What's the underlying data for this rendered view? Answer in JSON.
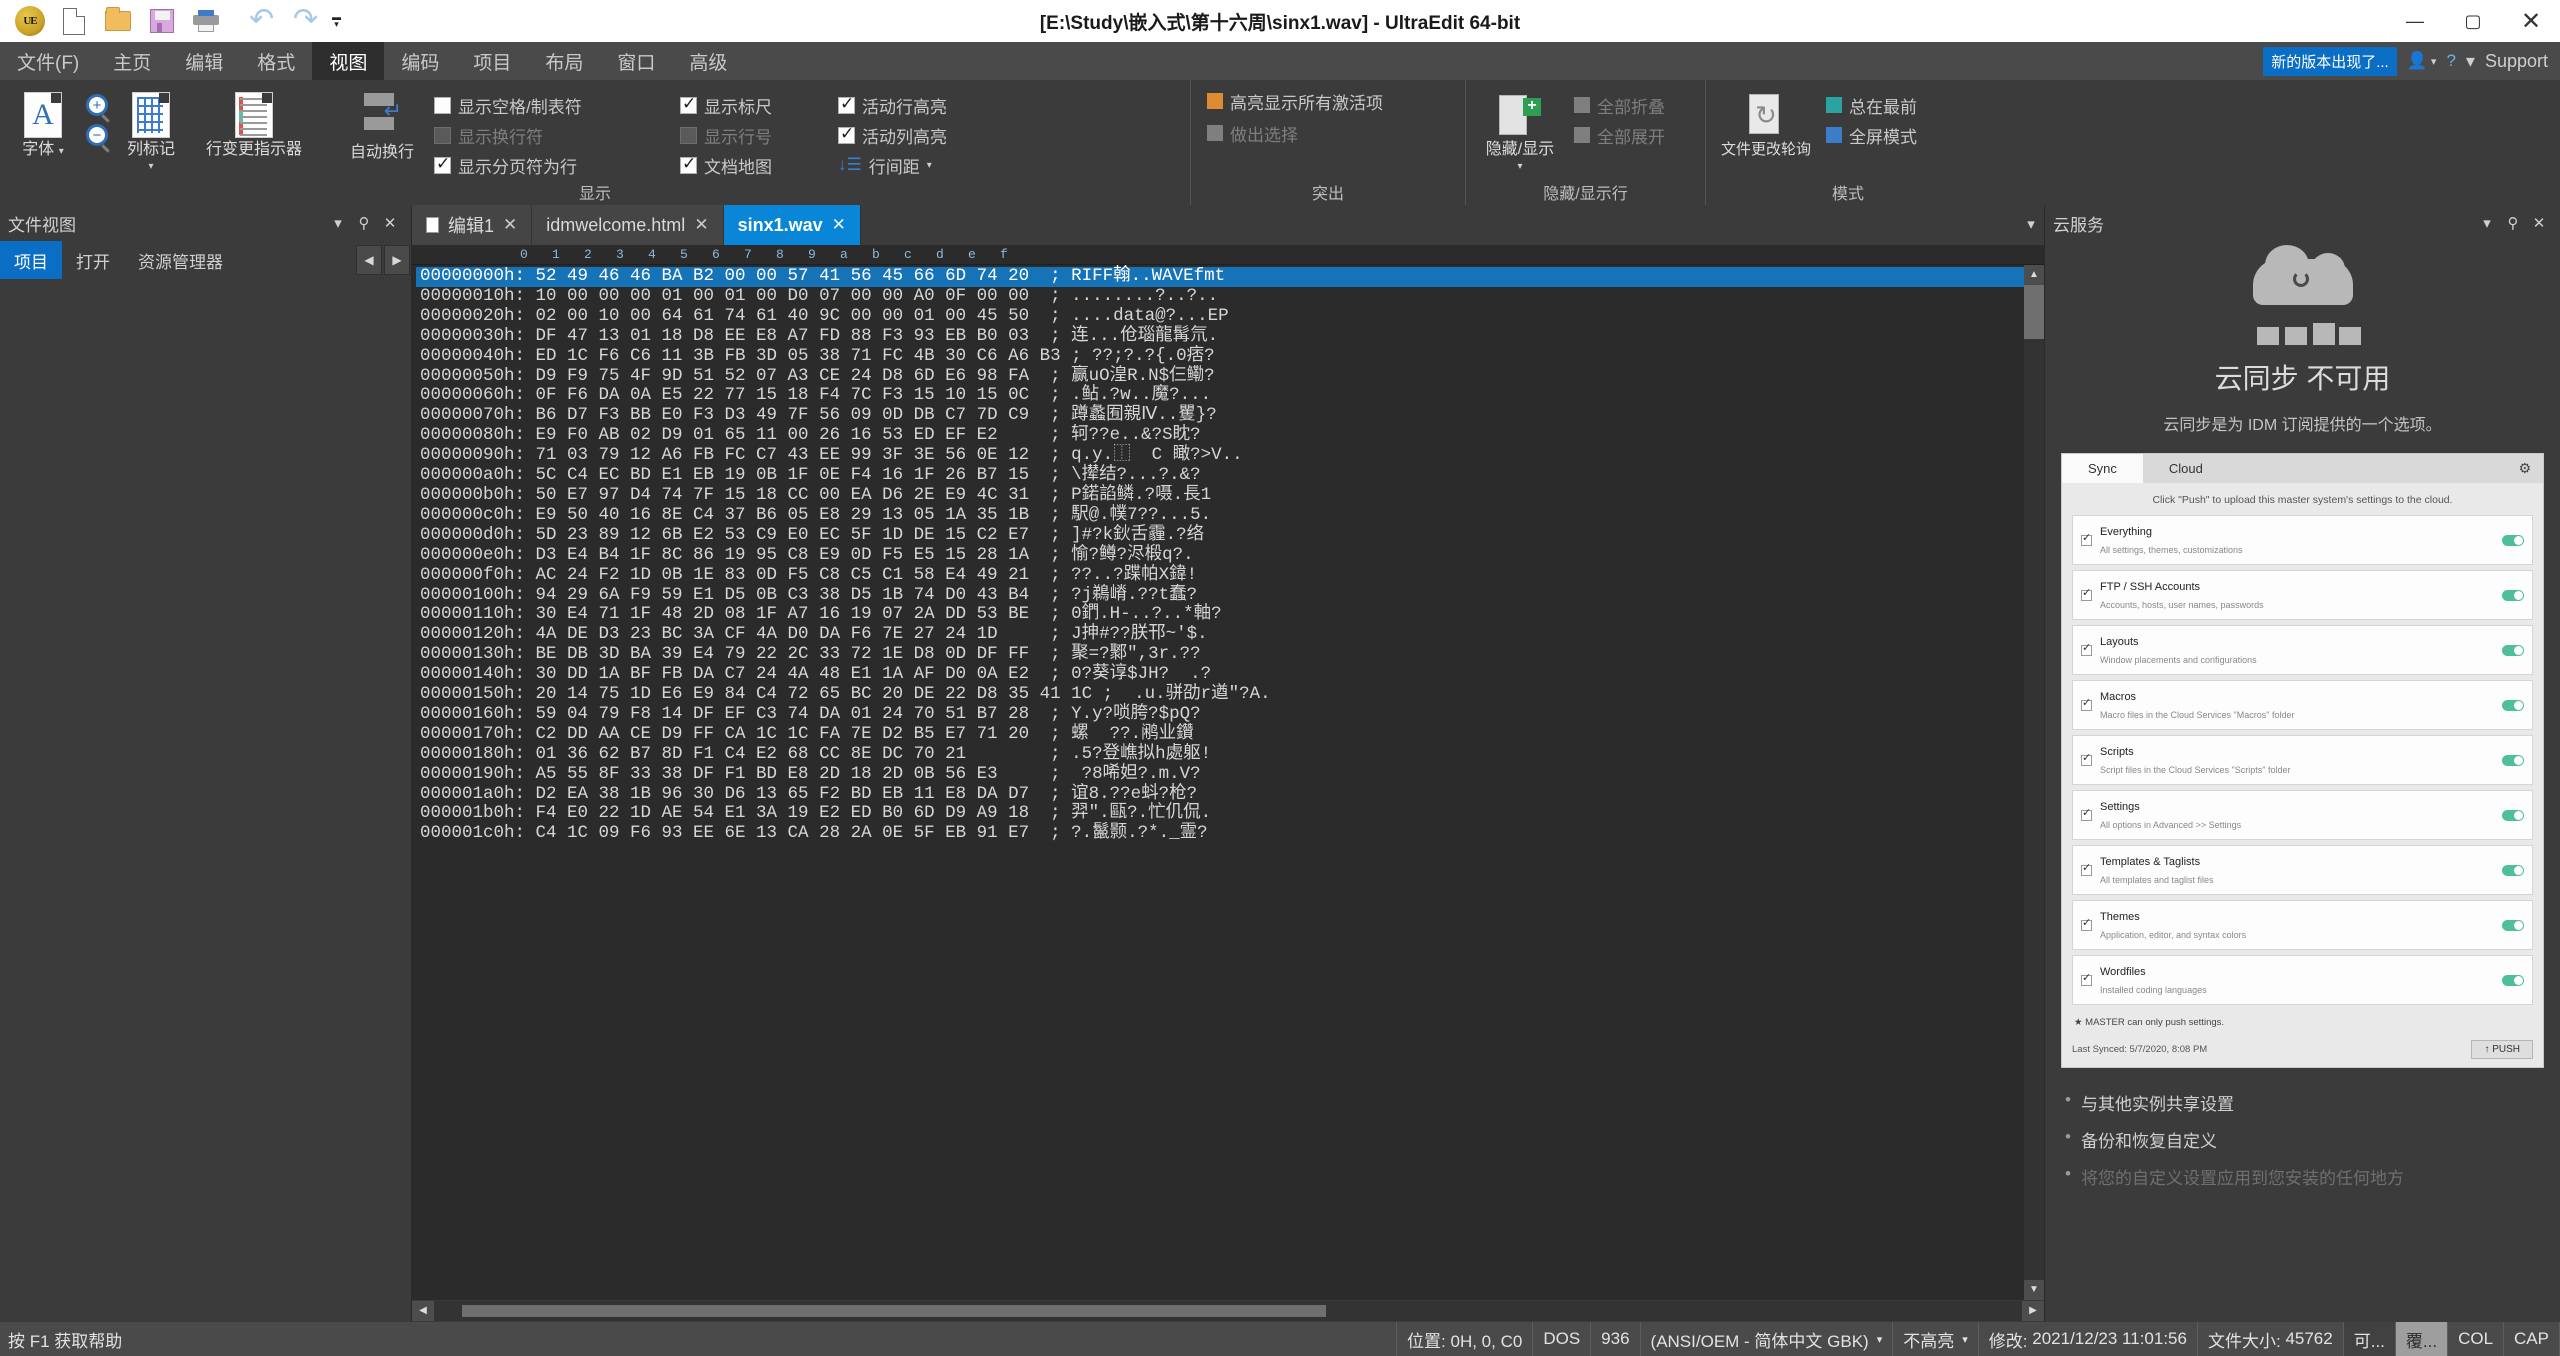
{
  "window": {
    "title": "[E:\\Study\\嵌入式\\第十六周\\sinx1.wav] - UltraEdit 64-bit",
    "minimize": "—",
    "maximize": "▢",
    "close": "✕"
  },
  "quick_access": {
    "logo": "UE",
    "items": [
      {
        "name": "new-file",
        "icon": "new-file-icon"
      },
      {
        "name": "open-file",
        "icon": "open-folder-icon"
      },
      {
        "name": "save-file",
        "icon": "save-disk-icon"
      },
      {
        "name": "print",
        "icon": "printer-icon"
      },
      {
        "name": "undo",
        "icon": "undo-arrow-icon",
        "glyph": "↶"
      },
      {
        "name": "redo",
        "icon": "redo-arrow-icon",
        "glyph": "↷"
      }
    ],
    "more": "▾"
  },
  "menubar": {
    "items": [
      {
        "label": "文件(F)",
        "active": false
      },
      {
        "label": "主页",
        "active": false
      },
      {
        "label": "编辑",
        "active": false
      },
      {
        "label": "格式",
        "active": false
      },
      {
        "label": "视图",
        "active": true
      },
      {
        "label": "编码",
        "active": false
      },
      {
        "label": "项目",
        "active": false
      },
      {
        "label": "布局",
        "active": false
      },
      {
        "label": "窗口",
        "active": false
      },
      {
        "label": "高级",
        "active": false
      }
    ],
    "new_version_badge": "新的版本出现了...",
    "account_icon": "user-account-icon",
    "help_icon": "help-question-icon",
    "support": "Support",
    "support_caret": "▾"
  },
  "ribbon": {
    "groups": [
      {
        "title": "显示",
        "font_button": {
          "label1": "字体",
          "caret": "▾",
          "icon": "font-document-icon"
        },
        "zoom_in_icon": "zoom-in-icon",
        "zoom_out_icon": "zoom-out-icon",
        "column_marker": {
          "label": "列标记",
          "caret": "▾",
          "icon": "column-marker-icon"
        },
        "line_change": {
          "label": "行变更指示器",
          "icon": "line-change-indicator-icon"
        },
        "word_wrap": {
          "label": "自动换行",
          "icon": "word-wrap-icon"
        },
        "checks": [
          {
            "label": "显示空格/制表符",
            "checked": false,
            "enabled": true
          },
          {
            "label": "显示换行符",
            "checked": false,
            "enabled": false
          },
          {
            "label": "显示分页符为行",
            "checked": true,
            "enabled": true
          },
          {
            "label": "显示标尺",
            "checked": true,
            "enabled": true
          },
          {
            "label": "显示行号",
            "checked": false,
            "enabled": false
          },
          {
            "label": "文档地图",
            "checked": true,
            "enabled": true
          },
          {
            "label": "活动行高亮",
            "checked": true,
            "enabled": true
          },
          {
            "label": "活动列高亮",
            "checked": true,
            "enabled": true
          },
          {
            "label": "行间距",
            "checked": false,
            "enabled": true,
            "caret": "▾",
            "icon": "line-spacing-icon"
          }
        ]
      },
      {
        "title": "突出",
        "items": [
          {
            "label": "高亮显示所有激活项",
            "checked": true,
            "swatch": "#e08a33"
          },
          {
            "label": "做出选择",
            "checked": false,
            "swatch": "#7f7f7f"
          }
        ]
      },
      {
        "title": "隐藏/显示行",
        "big": {
          "label": "隐藏/显示",
          "caret": "▾",
          "icon": "hide-show-icon"
        },
        "items": [
          {
            "label": "全部折叠",
            "checked": false,
            "swatch": "#7f7f7f"
          },
          {
            "label": "全部展开",
            "checked": false,
            "swatch": "#7f7f7f"
          }
        ]
      },
      {
        "title": "模式",
        "big": {
          "label": "文件更改轮询",
          "icon": "file-poll-icon"
        },
        "items": [
          {
            "label": "总在最前",
            "checked": false,
            "swatch": "#2aa3a3"
          },
          {
            "label": "全屏模式",
            "checked": false,
            "swatch": "#3d7cc9"
          }
        ]
      }
    ]
  },
  "left_panel": {
    "title": "文件视图",
    "caret": "▾",
    "pin": "📌",
    "close": "✕",
    "tabs": [
      {
        "label": "项目",
        "active": true
      },
      {
        "label": "打开",
        "active": false
      },
      {
        "label": "资源管理器",
        "active": false
      }
    ],
    "nav_prev": "◀",
    "nav_next": "▶"
  },
  "doc_tabs": [
    {
      "label": "编辑1",
      "active": false,
      "close": "✕",
      "icon": "file-icon"
    },
    {
      "label": "idmwelcome.html",
      "active": false,
      "close": "✕"
    },
    {
      "label": "sinx1.wav",
      "active": true,
      "close": "✕"
    }
  ],
  "ruler": {
    "ticks": [
      "0",
      "1",
      "2",
      "3",
      "4",
      "5",
      "6",
      "7",
      "8",
      "9",
      "a",
      "b",
      "c",
      "d",
      "e",
      "f"
    ]
  },
  "hex": {
    "selected_row": 0,
    "rows": [
      {
        "offset": "00000000h:",
        "bytes": "52 49 46 46 BA B2 00 00 57 41 56 45 66 6D 74 20",
        "ascii": "RIFF翰..WAVEfmt "
      },
      {
        "offset": "00000010h:",
        "bytes": "10 00 00 00 01 00 01 00 D0 07 00 00 A0 0F 00 00",
        "ascii": "........?..?.."
      },
      {
        "offset": "00000020h:",
        "bytes": "02 00 10 00 64 61 74 61 40 9C 00 00 01 00 45 50",
        "ascii": "....data@?...EP"
      },
      {
        "offset": "00000030h:",
        "bytes": "DF 47 13 01 18 D8 EE E8 A7 FD 88 F3 93 EB B0 03",
        "ascii": "连...伧瑙龍髯氘."
      },
      {
        "offset": "00000040h:",
        "bytes": "ED 1C F6 C6 11 3B FB 3D 05 38 71 FC 4B 30 C6 A6 B3",
        "ascii": "??;?.?{.0痞?"
      },
      {
        "offset": "00000050h:",
        "bytes": "D9 F9 75 4F 9D 51 52 07 A3 CE 24 D8 6D E6 98 FA",
        "ascii": "赢uO湟R.N$仨鳓?"
      },
      {
        "offset": "00000060h:",
        "bytes": "0F F6 DA 0A E5 22 77 15 18 F4 7C F3 15 10 15 0C",
        "ascii": ".鲇.?w..魔?..."
      },
      {
        "offset": "00000070h:",
        "bytes": "B6 D7 F3 BB E0 F3 D3 49 7F 56 09 0D DB C7 7D C9",
        "ascii": "蹲蠡囿親Ⅳ..矍}?"
      },
      {
        "offset": "00000080h:",
        "bytes": "E9 F0 AB 02 D9 01 65 11 00 26 16 53 ED EF E2",
        "ascii": "轲??e..&?S眈?"
      },
      {
        "offset": "00000090h:",
        "bytes": "71 03 79 12 A6 FB FC C7 43 EE 99 3F 3E 56 0E 12",
        "ascii": "q.y.⿰  C 瞰?>V.."
      },
      {
        "offset": "000000a0h:",
        "bytes": "5C C4 EC BD E1 EB 19 0B 1F 0E F4 16 1F 26 B7 15",
        "ascii": "\\撵结?...?.&?"
      },
      {
        "offset": "000000b0h:",
        "bytes": "50 E7 97 D4 74 7F 15 18 CC 00 EA D6 2E E9 4C 31",
        "ascii": "P鍩諂鳞.?嗫.長1"
      },
      {
        "offset": "000000c0h:",
        "bytes": "E9 50 40 16 8E C4 37 B6 05 E8 29 13 05 1A 35 1B",
        "ascii": "駅@.幞7??...5."
      },
      {
        "offset": "000000d0h:",
        "bytes": "5D 23 89 12 6B E2 53 C9 E0 EC 5F 1D DE 15 C2 E7",
        "ascii": "]#?k鈥舌霾.?络"
      },
      {
        "offset": "000000e0h:",
        "bytes": "D3 E4 B4 1F 8C 86 19 95 C8 E9 0D F5 E5 15 28 1A",
        "ascii": "愉?鳟?浕椴q?."
      },
      {
        "offset": "000000f0h:",
        "bytes": "AC 24 F2 1D 0B 1E 83 0D F5 C8 C5 C1 58 E4 49 21",
        "ascii": "??..?蹀帕X鍏!"
      },
      {
        "offset": "00000100h:",
        "bytes": "94 29 6A F9 59 E1 D5 0B C3 38 D5 1B 74 D0 43 B4",
        "ascii": "?j鵜嵴.??t蠢?"
      },
      {
        "offset": "00000110h:",
        "bytes": "30 E4 71 1F 48 2D 08 1F A7 16 19 07 2A DD 53 BE",
        "ascii": "0鍆.H-..?..*軸?"
      },
      {
        "offset": "00000120h:",
        "bytes": "4A DE D3 23 BC 3A CF 4A D0 DA F6 7E 27 24 1D",
        "ascii": "J抻#??朕邗~'$."
      },
      {
        "offset": "00000130h:",
        "bytes": "BE DB 3D BA 39 E4 79 22 2C 33 72 1E D8 0D DF FF",
        "ascii": "聚=?鄹\",3r.??"
      },
      {
        "offset": "00000140h:",
        "bytes": "30 DD 1A BF FB DA C7 24 4A 48 E1 1A AF D0 0A E2",
        "ascii": "0?葵谆$JH?  .?"
      },
      {
        "offset": "00000150h:",
        "bytes": "20 14 75 1D E6 E9 84 C4 72 65 BC 20 DE 22 D8 35 41 1C",
        "ascii": " .u.骈劭r遒\"?A."
      },
      {
        "offset": "00000160h:",
        "bytes": "59 04 79 F8 14 DF EF C3 74 DA 01 24 70 51 B7 28",
        "ascii": "Y.y?唢胯?$pQ?"
      },
      {
        "offset": "00000170h:",
        "bytes": "C2 DD AA CE D9 FF CA 1C 1C FA 7E D2 B5 E7 71 20",
        "ascii": "螺  ??.鹇业鑽"
      },
      {
        "offset": "00000180h:",
        "bytes": "01 36 62 B7 8D F1 C4 E2 68 CC 8E DC 70 21",
        "ascii": ".5?登嶕拟h處躯!"
      },
      {
        "offset": "00000190h:",
        "bytes": "A5 55 8F 33 38 DF F1 BD E8 2D 18 2D 0B 56 E3",
        "ascii": " ?8唏妲?.m.V?"
      },
      {
        "offset": "000001a0h:",
        "bytes": "D2 EA 38 1B 96 30 D6 13 65 F2 BD EB 11 E8 DA D7",
        "ascii": "谊8.??e蚪?枪?"
      },
      {
        "offset": "000001b0h:",
        "bytes": "F4 E0 22 1D AE 54 E1 3A 19 E2 ED B0 6D D9 A9 18",
        "ascii": "羿\".甌?.忙仉侃."
      },
      {
        "offset": "000001c0h:",
        "bytes": "C4 1C 09 F6 93 EE 6E 13 CA 28 2A 0E 5F EB 91 E7",
        "ascii": "?.鬣颢.?*._霊?"
      }
    ],
    "ascii_sep": ";"
  },
  "right_panel": {
    "title": "云服务",
    "caret": "▾",
    "pin": "📌",
    "close": "✕",
    "cloud_title": "云同步 不可用",
    "cloud_sub": "云同步是为 IDM 订阅提供的一个选项。",
    "card": {
      "tabs": [
        {
          "label": "Sync",
          "active": true
        },
        {
          "label": "Cloud",
          "active": false
        }
      ],
      "gear_icon": "gear-icon",
      "note": "Click \"Push\" to upload this master system's settings to the cloud.",
      "rows": [
        {
          "title": "Everything",
          "sub": "All settings, themes, customizations"
        },
        {
          "title": "FTP / SSH Accounts",
          "sub": "Accounts, hosts, user names, passwords"
        },
        {
          "title": "Layouts",
          "sub": "Window placements and configurations"
        },
        {
          "title": "Macros",
          "sub": "Macro files in the Cloud Services \"Macros\" folder"
        },
        {
          "title": "Scripts",
          "sub": "Script files in the Cloud Services \"Scripts\" folder"
        },
        {
          "title": "Settings",
          "sub": "All options in Advanced >> Settings"
        },
        {
          "title": "Templates & Taglists",
          "sub": "All templates and taglist files"
        },
        {
          "title": "Themes",
          "sub": "Application, editor, and syntax colors"
        },
        {
          "title": "Wordfiles",
          "sub": "Installed coding languages"
        }
      ],
      "master_note": "★ MASTER can only push settings.",
      "last_synced": "Last Synced: 5/7/2020, 8:08 PM",
      "push_label": "↑ PUSH"
    },
    "bullets": [
      "与其他实例共享设置",
      "备份和恢复自定义",
      "将您的自定义设置应用到您安装的任何地方"
    ]
  },
  "statusbar": {
    "help": "按 F1 获取帮助",
    "position": "位置: 0H, 0, C0",
    "line_ending": "DOS",
    "codepage": "936",
    "encoding": "(ANSI/OEM - 简体中文 GBK)",
    "encoding_caret": "▾",
    "highlight": "不高亮",
    "highlight_caret": "▾",
    "modified_label": "修改:",
    "modified_value": "2021/12/23 11:01:56",
    "filesize_label": "文件大小:",
    "filesize_value": "45762",
    "ins_mode": "可...",
    "ovr_mode": "覆...",
    "col": "COL",
    "cap": "CAP"
  }
}
